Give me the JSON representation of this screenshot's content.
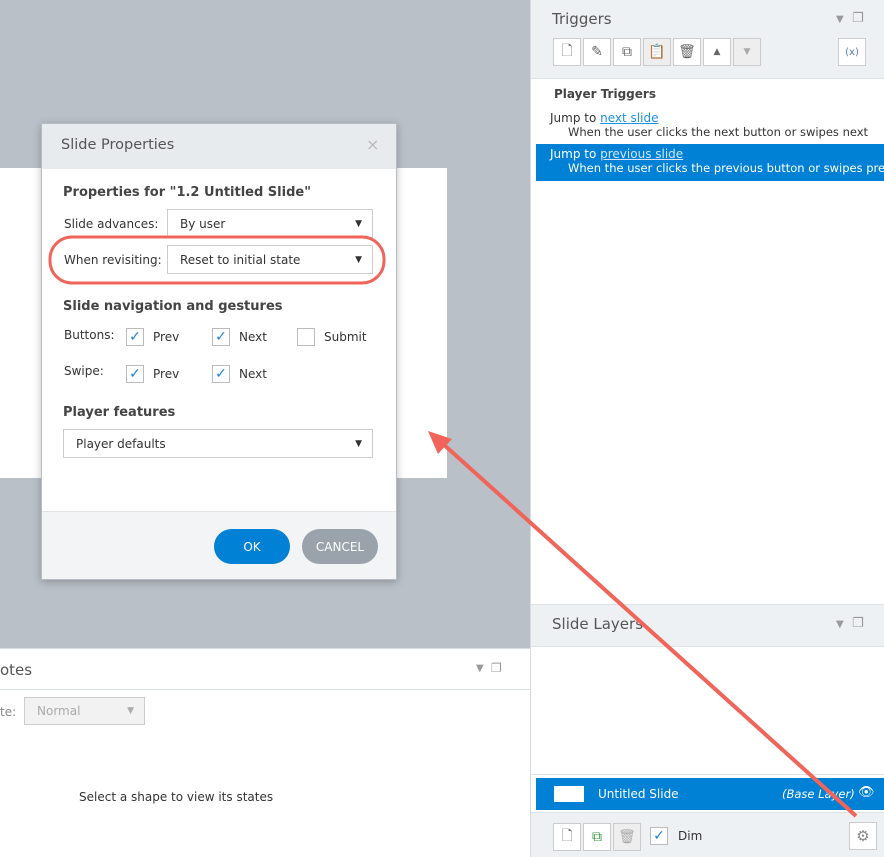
{
  "dialog": {
    "title": "Slide Properties",
    "close": "×",
    "properties_for": "Properties for \"1.2 Untitled Slide\"",
    "slide_advances_label": "Slide advances:",
    "slide_advances_value": "By user",
    "when_revisiting_label": "When revisiting:",
    "when_revisiting_value": "Reset to initial state",
    "nav_heading": "Slide navigation and gestures",
    "buttons_label": "Buttons:",
    "swipe_label": "Swipe:",
    "prev": "Prev",
    "next": "Next",
    "submit": "Submit",
    "buttons": {
      "prev": true,
      "next": true,
      "submit": false
    },
    "swipe": {
      "prev": true,
      "next": true
    },
    "player_features_heading": "Player features",
    "player_features_value": "Player defaults",
    "ok": "OK",
    "cancel": "CANCEL"
  },
  "notes": {
    "title": "otes",
    "state_label": "te:",
    "state_value": "Normal",
    "empty_text": "Select a shape to view its states"
  },
  "triggers": {
    "title": "Triggers",
    "section": "Player Triggers",
    "items": [
      {
        "action": "Jump to",
        "target": "next slide",
        "condition": "When the user clicks the next button or swipes next",
        "selected": false
      },
      {
        "action": "Jump to",
        "target": "previous slide",
        "condition": "When the user clicks the previous button or swipes prev...",
        "selected": true
      }
    ]
  },
  "layers": {
    "title": "Slide Layers",
    "layer_name": "Untitled Slide",
    "layer_tag": "(Base Layer)",
    "dim_label": "Dim",
    "dim_checked": true
  },
  "colors": {
    "accent": "#0081d6",
    "annotation": "#f0645a"
  }
}
